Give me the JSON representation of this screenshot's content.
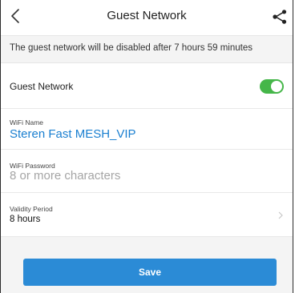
{
  "header": {
    "title": "Guest Network",
    "back_icon": "chevron-left-icon",
    "share_icon": "share-icon"
  },
  "notice": {
    "text": "The guest network will be disabled after 7 hours 59 minutes"
  },
  "guest_network": {
    "label": "Guest Network",
    "enabled": true,
    "toggle_color": "#45b649"
  },
  "wifi_name": {
    "label": "WiFi Name",
    "value": "Steren Fast MESH_VIP",
    "color": "#1a7fd0"
  },
  "wifi_password": {
    "label": "WiFi Password",
    "value": "",
    "placeholder": "8 or more characters"
  },
  "validity": {
    "label": "Validity Period",
    "value": "8 hours",
    "chevron_icon": "chevron-right-icon"
  },
  "footer": {
    "save_label": "Save",
    "save_color": "#2b8bd6"
  }
}
